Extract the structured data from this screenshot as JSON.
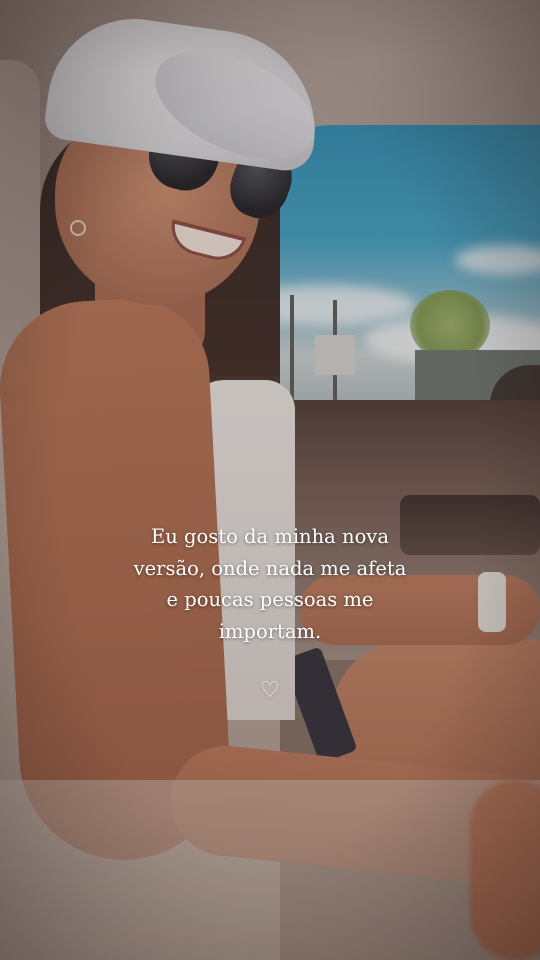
{
  "story": {
    "caption_lines": [
      "Eu gosto da minha nova",
      "versão, onde nada me afeta",
      "e poucas pessoas me",
      "importam."
    ],
    "heart_glyph": "♡",
    "heart_icon": "white-heart-icon",
    "heart_color": "#f4f1ee",
    "text_color": "#ffffff"
  }
}
